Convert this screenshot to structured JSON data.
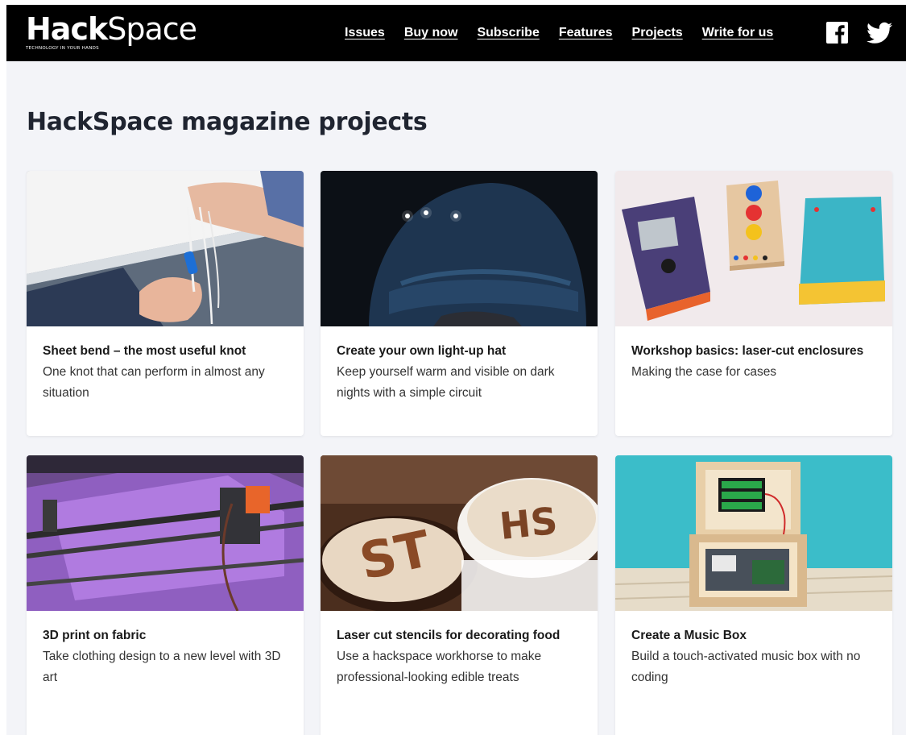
{
  "site": {
    "logo_hack": "Hack",
    "logo_space": "Space",
    "logo_tagline": "TECHNOLOGY IN YOUR HANDS"
  },
  "nav": {
    "items": [
      {
        "label": "Issues"
      },
      {
        "label": "Buy now"
      },
      {
        "label": "Subscribe"
      },
      {
        "label": "Features"
      },
      {
        "label": "Projects"
      },
      {
        "label": "Write for us"
      }
    ],
    "social": [
      "facebook-icon",
      "twitter-icon"
    ]
  },
  "page": {
    "title": "HackSpace magazine projects"
  },
  "projects": [
    {
      "title": "Sheet bend – the most useful knot",
      "description": "One knot that can perform in almost any situation",
      "image": "hands-tying-knot-photo"
    },
    {
      "title": "Create your own light-up hat",
      "description": "Keep yourself warm and visible on dark nights with a simple circuit",
      "image": "led-beanie-hat-photo"
    },
    {
      "title": "Workshop basics: laser-cut enclosures",
      "description": "Making the case for cases",
      "image": "laser-cut-enclosures-photo"
    },
    {
      "title": "3D print on fabric",
      "description": "Take clothing design to a new level with 3D art",
      "image": "3d-printer-on-fabric-photo"
    },
    {
      "title": "Laser cut stencils for decorating food",
      "description": "Use a hackspace workhorse to make professional-looking edible treats",
      "image": "coffee-stencil-photo"
    },
    {
      "title": "Create a Music Box",
      "description": "Build a touch-activated music box with no coding",
      "image": "wooden-music-box-photo"
    }
  ],
  "colors": {
    "header_bg": "#000000",
    "page_bg": "#f3f4f8",
    "card_bg": "#ffffff",
    "title_text": "#1f2430"
  }
}
